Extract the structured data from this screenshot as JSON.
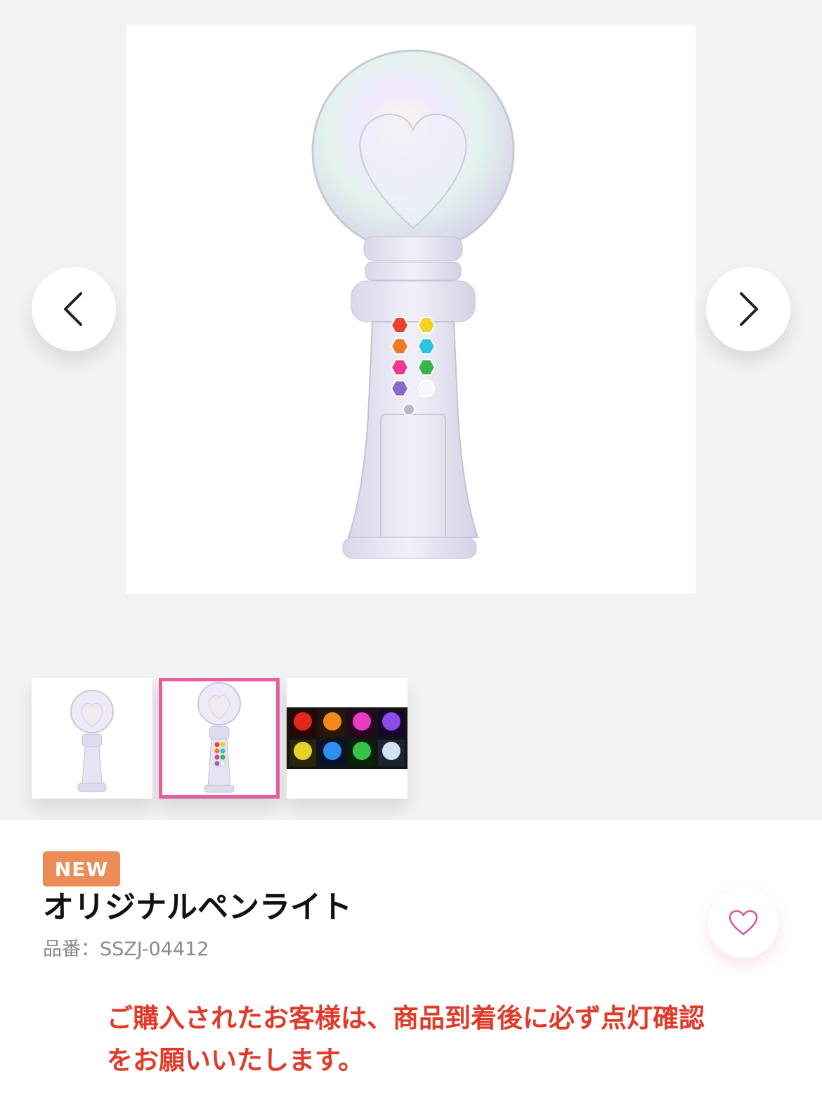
{
  "gallery": {
    "main_image_alt": "",
    "prev_icon": "chevron-left-icon",
    "next_icon": "chevron-right-icon",
    "thumbnails": [
      {
        "icon": "penlight-front-thumbnail",
        "selected": false
      },
      {
        "icon": "penlight-buttons-thumbnail",
        "selected": true
      },
      {
        "icon": "penlight-colors-thumbnail",
        "selected": false
      }
    ],
    "selected_border_color": "#e5609e"
  },
  "product": {
    "badge": "NEW",
    "badge_color": "#ec8b55",
    "title": "オリジナルペンライト",
    "code": "品番：SSZJ-04412",
    "favorite_icon": "heart-outline-icon",
    "favorite_color": "#d9559a",
    "notice": "ご購入されたお客様は、商品到着後に必ず点灯確認をお願いいたします。",
    "notice_color": "#e03a2a"
  }
}
